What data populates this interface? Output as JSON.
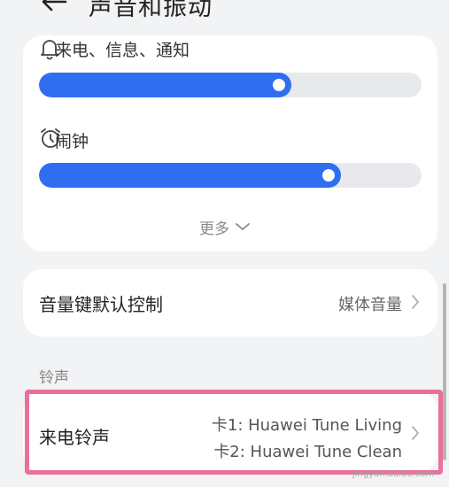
{
  "header": {
    "title": "声音和振动",
    "back_icon": "back-arrow-icon"
  },
  "volume": {
    "ring": {
      "label": "来电、信息、通知",
      "icon": "bell-icon",
      "level": 0.66
    },
    "alarm": {
      "label": "闹钟",
      "icon": "alarm-clock-icon",
      "level": 0.79
    },
    "more_label": "更多"
  },
  "volume_key": {
    "label": "音量键默认控制",
    "value": "媒体音量"
  },
  "ringtone_section": {
    "title": "铃声",
    "incoming_label": "来电铃声",
    "sim1": "卡1: Huawei Tune Living",
    "sim2": "卡2: Huawei Tune Clean"
  },
  "watermark": "jingyan.baidu.com",
  "colors": {
    "accent": "#2f6ef0",
    "highlight": "#e8709a",
    "background": "#f1f3f5"
  }
}
